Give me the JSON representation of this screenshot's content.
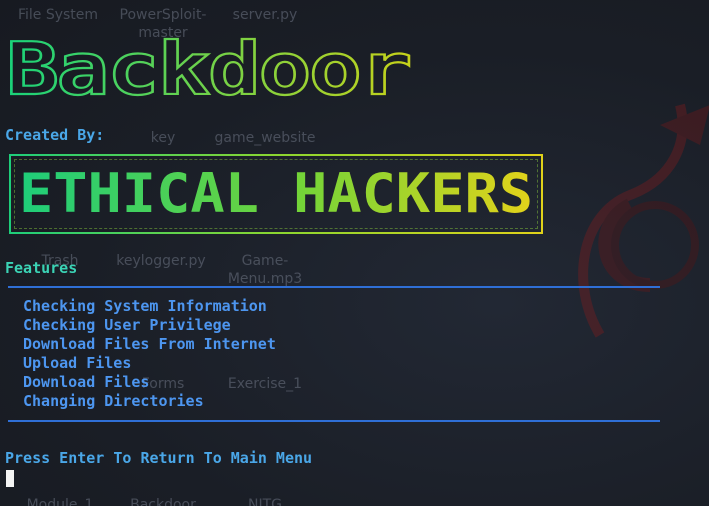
{
  "desktop": {
    "icons": [
      {
        "label": "File System"
      },
      {
        "label": "PowerSploit-master"
      },
      {
        "label": "server.py"
      },
      {
        "label": "key"
      },
      {
        "label": "game_website"
      },
      {
        "label": "Trash"
      },
      {
        "label": "keylogger.py"
      },
      {
        "label": "Game-Menu.mp3"
      },
      {
        "label": "Forms"
      },
      {
        "label": "Exercise_1"
      },
      {
        "label": "Module_1"
      },
      {
        "label": "Backdoor"
      },
      {
        "label": "NITG"
      }
    ]
  },
  "terminal": {
    "banner_text": "Backdoor",
    "created_by_label": "Created By:",
    "author_banner_text": "ETHICAL HACKERS",
    "features_title": "Features",
    "features": [
      "Checking System Information",
      "Checking User Privilege",
      "Download Files From Internet",
      "Upload Files",
      "Download Files",
      "Changing Directories"
    ],
    "prompt": "Press Enter To Return To Main Menu"
  },
  "colors": {
    "banner_gradient_start": "#19d27a",
    "banner_gradient_end": "#c6d21a",
    "accent_blue": "#4d96f0",
    "features_teal": "#3bd3b5",
    "rule_blue": "#2f6fd6"
  }
}
